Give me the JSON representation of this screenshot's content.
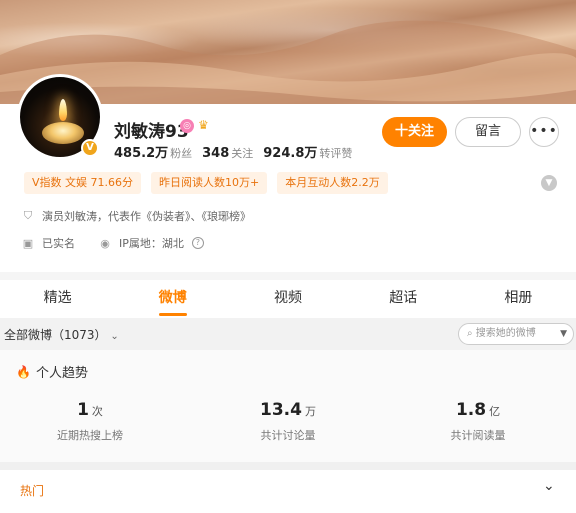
{
  "profile": {
    "name": "刘敏涛93",
    "followers_value": "485.2万",
    "followers_label": "粉丝",
    "following_value": "348",
    "following_label": "关注",
    "reposts_value": "924.8万",
    "reposts_label": "转评赞",
    "follow_label": "十关注",
    "message_label": "留言",
    "more_label": "•••"
  },
  "tags": [
    "V指数 文娱 71.66分",
    "昨日阅读人数10万+",
    "本月互动人数2.2万"
  ],
  "info": {
    "bio": "演员刘敏涛，代表作《伪装者》、《琅琊榜》",
    "verified": "已实名",
    "ip_location": "IP属地：湖北"
  },
  "tabs": [
    "精选",
    "微博",
    "视频",
    "超话",
    "相册"
  ],
  "filter": {
    "all_label": "全部微博（1073）",
    "search_placeholder": "搜索她的微博"
  },
  "trend": {
    "title": "个人趋势",
    "metrics": [
      {
        "value": "1",
        "unit": "次",
        "label": "近期热搜上榜"
      },
      {
        "value": "13.4",
        "unit": "万",
        "label": "共计讨论量"
      },
      {
        "value": "1.8",
        "unit": "亿",
        "label": "共计阅读量"
      }
    ]
  },
  "hot_label": "热门",
  "colors": {
    "accent": "#ff8200",
    "tag_bg": "#fff2e5"
  }
}
